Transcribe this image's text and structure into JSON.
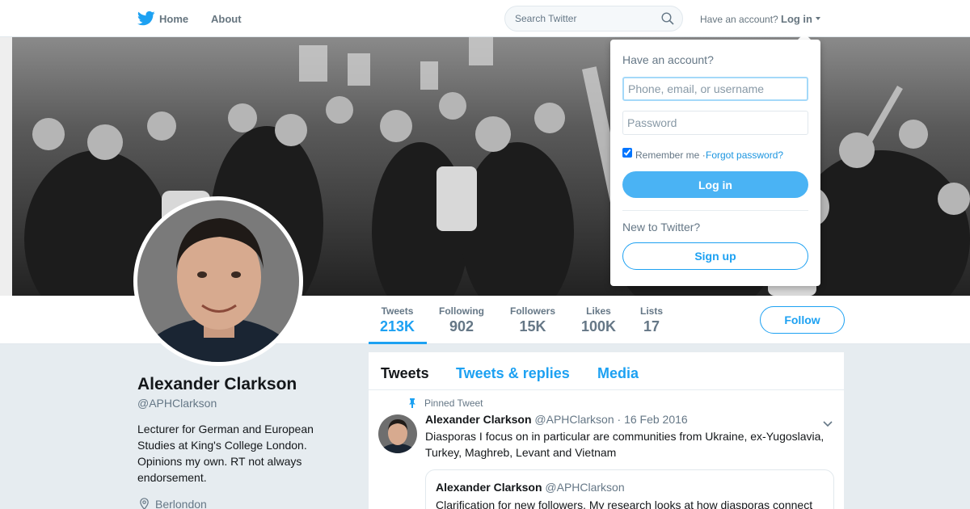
{
  "nav": {
    "home_label": "Home",
    "about_label": "About",
    "search_placeholder": "Search Twitter",
    "have_account": "Have an account?",
    "login_label": "Log in",
    "brand_color": "#1da1f2"
  },
  "profile": {
    "name": "Alexander Clarkson",
    "handle": "@APHClarkson",
    "bio": "Lecturer for German and European Studies at King's College London. Opinions my own. RT not always endorsement.",
    "location": "Berlondon"
  },
  "stats": [
    {
      "label": "Tweets",
      "value": "213K"
    },
    {
      "label": "Following",
      "value": "902"
    },
    {
      "label": "Followers",
      "value": "15K"
    },
    {
      "label": "Likes",
      "value": "100K"
    },
    {
      "label": "Lists",
      "value": "17"
    }
  ],
  "follow_label": "Follow",
  "timeline": {
    "tabs": [
      "Tweets",
      "Tweets & replies",
      "Media"
    ],
    "pinned_label": "Pinned Tweet",
    "tweet": {
      "name": "Alexander Clarkson",
      "meta": "@APHClarkson · 16 Feb 2016",
      "text": "Diasporas I focus on in particular are communities from Ukraine, ex-Yugoslavia, Turkey, Maghreb, Levant and Vietnam"
    },
    "quote": {
      "name": "Alexander Clarkson",
      "handle": "@APHClarkson",
      "text": "Clarification for new followers. My research looks at how diasporas connect"
    }
  },
  "login_dropdown": {
    "title": "Have an account?",
    "username_placeholder": "Phone, email, or username",
    "password_placeholder": "Password",
    "remember_label": "Remember me",
    "separator": " · ",
    "forgot_label": "Forgot password?",
    "login_button": "Log in",
    "new_label": "New to Twitter?",
    "signup_button": "Sign up"
  }
}
